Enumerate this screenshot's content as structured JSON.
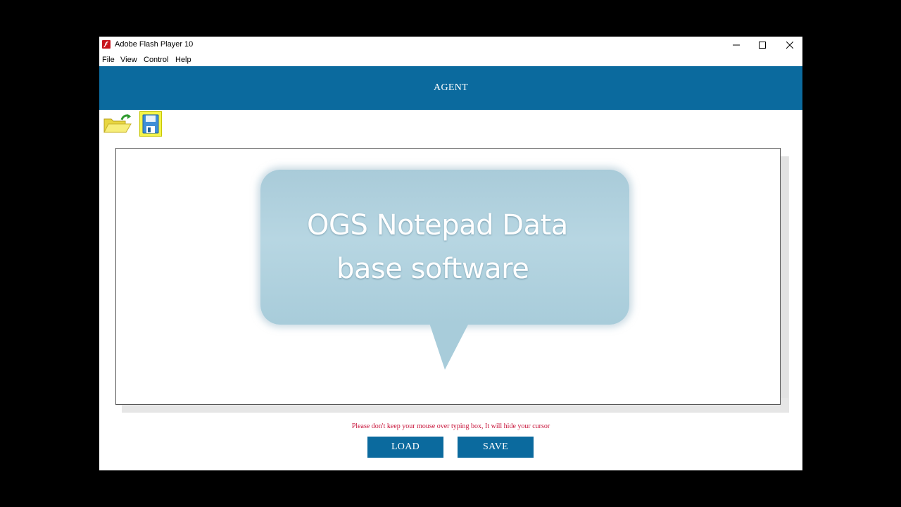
{
  "window": {
    "title": "Adobe Flash Player 10",
    "controls": {
      "minimize_icon": "minimize-icon",
      "maximize_icon": "maximize-icon",
      "close_icon": "close-icon"
    }
  },
  "menu": {
    "items": [
      {
        "label": "File"
      },
      {
        "label": "View"
      },
      {
        "label": "Control"
      },
      {
        "label": "Help"
      }
    ]
  },
  "header": {
    "title": "AGENT",
    "color": "#0b6a9e"
  },
  "toolbar": {
    "open_icon": "open-folder-icon",
    "save_icon": "floppy-disk-icon"
  },
  "editor": {
    "bubble_text_line1": "OGS Notepad Data",
    "bubble_text_line2": "base software"
  },
  "footer": {
    "hint": "Please don't keep your mouse over typing box, It will hide your cursor",
    "load_label": "LOAD",
    "save_label": "SAVE",
    "hint_color": "#c8143a"
  }
}
